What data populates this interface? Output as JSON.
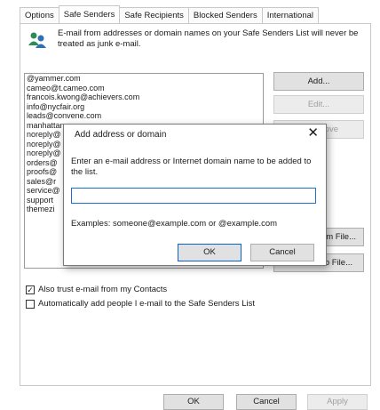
{
  "tabs": [
    "Options",
    "Safe Senders",
    "Safe Recipients",
    "Blocked Senders",
    "International"
  ],
  "intro_text": "E-mail from addresses or domain names on your Safe Senders List will never be treated as junk e-mail.",
  "senders": [
    "@yammer.com",
    "cameo@t.cameo.com",
    "francois.kwong@achievers.com",
    "info@nycfair.org",
    "leads@convene.com",
    "manhattan",
    "noreply@",
    "noreply@",
    "noreply@",
    "orders@",
    "proofs@",
    "sales@r",
    "service@",
    "support",
    "themezi"
  ],
  "side_buttons": {
    "add": "Add...",
    "edit": "Edit...",
    "remove": "Remove",
    "import": "Import from File...",
    "export": "Export to File..."
  },
  "side_buttons_visible": {
    "remove": "ove",
    "import": "om File...",
    "export": "o File..."
  },
  "checkboxes": [
    {
      "label": "Also trust e-mail from my Contacts",
      "checked": true
    },
    {
      "label": "Automatically add people I e-mail to the Safe Senders List",
      "checked": false
    }
  ],
  "footer": {
    "ok": "OK",
    "cancel": "Cancel",
    "apply": "Apply"
  },
  "dialog": {
    "title": "Add address or domain",
    "close": "✕",
    "prompt": "Enter an e-mail address or Internet domain name to be added to the list.",
    "input_value": "",
    "examples": "Examples: someone@example.com or @example.com",
    "ok": "OK",
    "cancel": "Cancel"
  },
  "colors": {
    "input_focus": "#1a6fd0",
    "icon_person1": "#2e8b57",
    "icon_person2": "#2f6fb3"
  }
}
